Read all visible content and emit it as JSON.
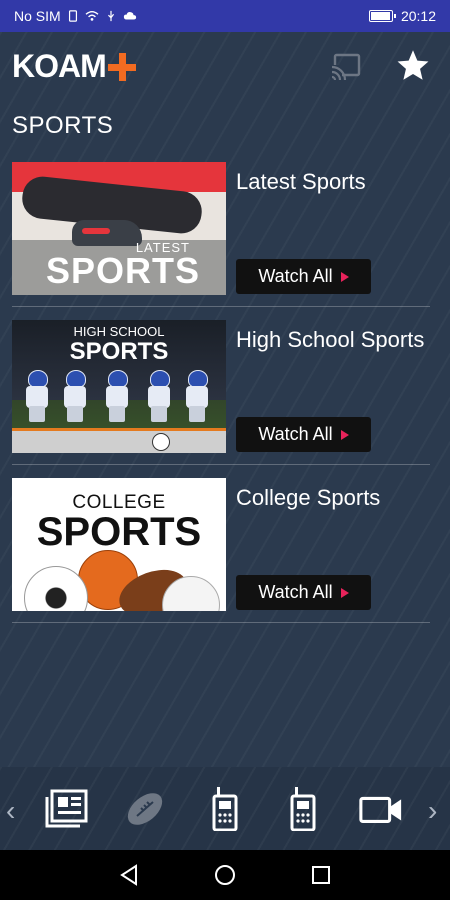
{
  "status_bar": {
    "carrier": "No SIM",
    "time": "20:12"
  },
  "header": {
    "logo": "KOAM",
    "cast_icon": "cast-icon",
    "favorite_icon": "star-icon"
  },
  "section": {
    "title": "SPORTS"
  },
  "cards": [
    {
      "title": "Latest Sports",
      "button": "Watch All",
      "thumb_small": "LATEST",
      "thumb_big": "SPORTS"
    },
    {
      "title": "High School Sports",
      "button": "Watch All",
      "thumb_small": "HIGH SCHOOL",
      "thumb_big": "SPORTS"
    },
    {
      "title": "College Sports",
      "button": "Watch All",
      "thumb_small": "COLLEGE",
      "thumb_big": "SPORTS"
    }
  ],
  "bottom_nav": {
    "prev": "‹",
    "next": "›",
    "items": [
      "news-icon",
      "football-icon",
      "walkie-talkie-icon",
      "walkie-talkie-icon",
      "video-camera-icon"
    ]
  },
  "colors": {
    "status_bar": "#3239a8",
    "background": "#2b3a4e",
    "accent_orange": "#f26b21",
    "play_pink": "#e8235b"
  }
}
